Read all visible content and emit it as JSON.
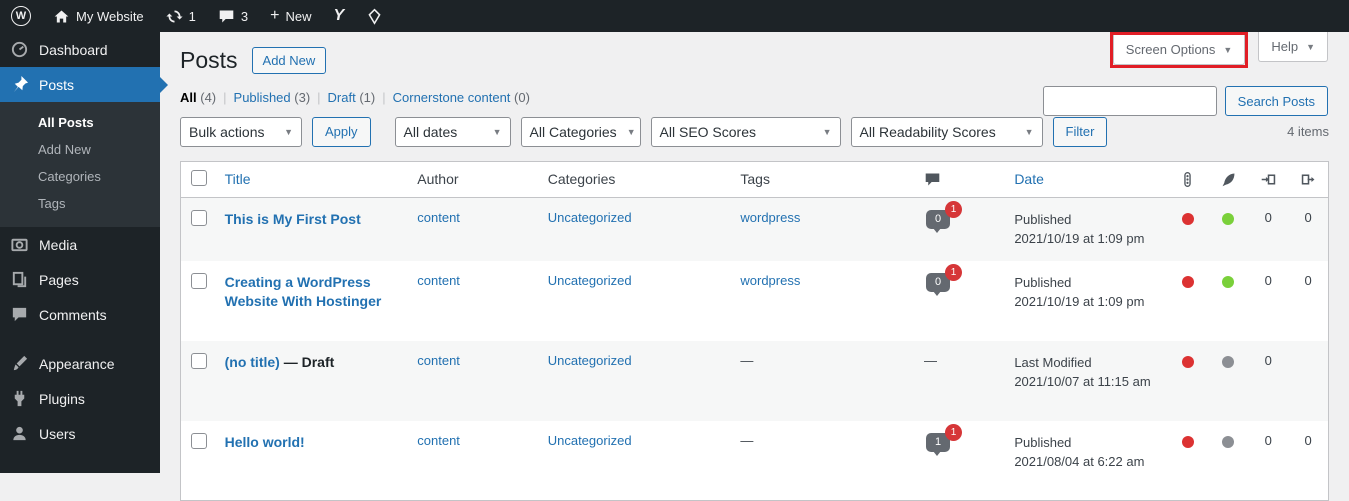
{
  "colors": {
    "accent_blue": "#2271b1",
    "badge_red": "#d63638",
    "annotation_red": "#e11e26",
    "seo_red": "#dc3232",
    "readability_green": "#7ad03a",
    "score_gray": "#8c8f94"
  },
  "icons": {
    "plus": "+",
    "chevron_down": "▼",
    "yoast": "Y",
    "wordpress": "W"
  },
  "admin_bar": {
    "site_name": "My Website",
    "updates_count": "1",
    "comments_count": "3",
    "new_label": "New"
  },
  "sidebar": {
    "dashboard": "Dashboard",
    "posts": "Posts",
    "submenu": {
      "all_posts": "All Posts",
      "add_new": "Add New",
      "categories": "Categories",
      "tags": "Tags"
    },
    "media": "Media",
    "pages": "Pages",
    "comments": "Comments",
    "appearance": "Appearance",
    "plugins": "Plugins",
    "users": "Users"
  },
  "top_tabs": {
    "screen_options": "Screen Options",
    "help": "Help"
  },
  "page": {
    "title": "Posts",
    "add_new": "Add New"
  },
  "views_separator": "|",
  "views": [
    {
      "label": "All",
      "count": "(4)"
    },
    {
      "label": "Published",
      "count": "(3)"
    },
    {
      "label": "Draft",
      "count": "(1)"
    },
    {
      "label": "Cornerstone content",
      "count": "(0)"
    }
  ],
  "search": {
    "value": "",
    "button": "Search Posts"
  },
  "filters": {
    "bulk_actions": "Bulk actions",
    "apply": "Apply",
    "all_dates": "All dates",
    "all_categories": "All Categories",
    "all_seo_scores": "All SEO Scores",
    "all_readability_scores": "All Readability Scores",
    "filter": "Filter",
    "items_count": "4 items"
  },
  "table": {
    "headers": {
      "title": "Title",
      "author": "Author",
      "categories": "Categories",
      "tags": "Tags",
      "date": "Date"
    },
    "rows": [
      {
        "title": "This is My First Post",
        "author": "content",
        "categories": "Uncategorized",
        "tags": "wordpress",
        "comments": "0",
        "pending": "1",
        "status": "Published",
        "date": "2021/10/19 at 1:09 pm",
        "seo_color": "#dc3232",
        "readability_color": "#7ad03a",
        "links": "0",
        "linked": "0"
      },
      {
        "title": "Creating a WordPress Website With Hostinger",
        "author": "content",
        "categories": "Uncategorized",
        "tags": "wordpress",
        "comments": "0",
        "pending": "1",
        "status": "Published",
        "date": "2021/10/19 at 1:09 pm",
        "seo_color": "#dc3232",
        "readability_color": "#7ad03a",
        "links": "0",
        "linked": "0"
      },
      {
        "title": "(no title)",
        "title_suffix": " — Draft",
        "author": "content",
        "categories": "Uncategorized",
        "tags": "—",
        "comments": "—",
        "status": "Last Modified",
        "date": "2021/10/07 at 11:15 am",
        "seo_color": "#dc3232",
        "readability_color": "#8c8f94",
        "links": "0",
        "linked": ""
      },
      {
        "title": "Hello world!",
        "author": "content",
        "categories": "Uncategorized",
        "tags": "—",
        "comments": "1",
        "pending": "1",
        "status": "Published",
        "date": "2021/08/04 at 6:22 am",
        "seo_color": "#dc3232",
        "readability_color": "#8c8f94",
        "links": "0",
        "linked": "0"
      }
    ]
  }
}
